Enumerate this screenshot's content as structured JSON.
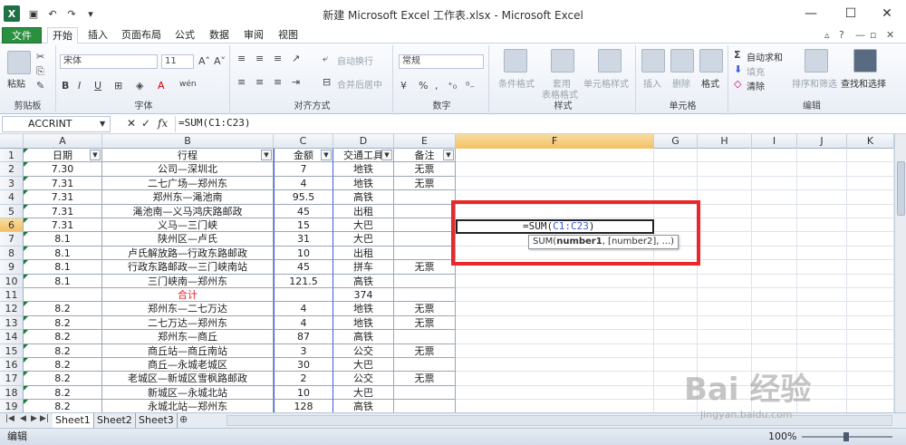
{
  "window": {
    "title": "新建 Microsoft Excel 工作表.xlsx - Microsoft Excel",
    "logo": "X"
  },
  "tabs": [
    "文件",
    "开始",
    "插入",
    "页面布局",
    "公式",
    "数据",
    "审阅",
    "视图"
  ],
  "active_tab": "开始",
  "ribbon": {
    "clipboard": {
      "label": "剪贴板",
      "paste": "粘贴"
    },
    "font": {
      "label": "字体",
      "name": "宋体",
      "size": "11",
      "bold": "B",
      "italic": "I",
      "underline": "U",
      "grow": "A˄",
      "shrink": "A˅",
      "wen": "wén"
    },
    "alignment": {
      "label": "对齐方式",
      "wrap": "自动换行",
      "merge": "合并后居中"
    },
    "number": {
      "label": "数字",
      "format": "常规",
      "pct": "%",
      "comma": ","
    },
    "styles": {
      "label": "样式",
      "conditional": "条件格式",
      "table1": "套用",
      "table2": "表格格式",
      "cell": "单元格样式"
    },
    "cells": {
      "label": "单元格",
      "insert": "插入",
      "delete": "删除",
      "format": "格式"
    },
    "editing": {
      "label": "编辑",
      "autosum": "自动求和",
      "fill": "填充",
      "clear": "清除",
      "sort": "排序和筛选",
      "find": "查找和选择"
    }
  },
  "formula_bar": {
    "name_box": "ACCRINT",
    "formula": "=SUM(C1:C23)",
    "fx": "fx"
  },
  "columns": [
    "A",
    "B",
    "C",
    "D",
    "E",
    "F",
    "G",
    "H",
    "I",
    "J",
    "K"
  ],
  "selected_column": "F",
  "selected_row": "6",
  "row_numbers": [
    "1",
    "2",
    "3",
    "4",
    "5",
    "6",
    "7",
    "8",
    "9",
    "10",
    "11",
    "12",
    "13",
    "14",
    "15",
    "16",
    "17",
    "18",
    "19"
  ],
  "table": {
    "headers": [
      "日期",
      "行程",
      "金额",
      "交通工具",
      "备注"
    ],
    "rows": [
      [
        "7.30",
        "公司—深圳北",
        "7",
        "地铁",
        "无票"
      ],
      [
        "7.31",
        "二七广场—郑州东",
        "4",
        "地铁",
        "无票"
      ],
      [
        "7.31",
        "郑州东—渑池南",
        "95.5",
        "高铁",
        ""
      ],
      [
        "7.31",
        "渑池南—义马鸿庆路邮政",
        "45",
        "出租",
        ""
      ],
      [
        "7.31",
        "义马—三门峡",
        "15",
        "大巴",
        ""
      ],
      [
        "8.1",
        "陕州区—卢氏",
        "31",
        "大巴",
        ""
      ],
      [
        "8.1",
        "卢氏解放路—行政东路邮政",
        "10",
        "出租",
        ""
      ],
      [
        "8.1",
        "行政东路邮政—三门峡南站",
        "45",
        "拼车",
        "无票"
      ],
      [
        "8.1",
        "三门峡南—郑州东",
        "121.5",
        "高铁",
        ""
      ],
      [
        "",
        "合计",
        "",
        "374",
        ""
      ],
      [
        "8.2",
        "郑州东—二七万达",
        "4",
        "地铁",
        "无票"
      ],
      [
        "8.2",
        "二七万达—郑州东",
        "4",
        "地铁",
        "无票"
      ],
      [
        "8.2",
        "郑州东—商丘",
        "87",
        "高铁",
        ""
      ],
      [
        "8.2",
        "商丘站—商丘南站",
        "3",
        "公交",
        "无票"
      ],
      [
        "8.2",
        "商丘—永城老城区",
        "30",
        "大巴",
        ""
      ],
      [
        "8.2",
        "老城区—新城区雪枫路邮政",
        "2",
        "公交",
        "无票"
      ],
      [
        "8.2",
        "新城区—永城北站",
        "10",
        "大巴",
        ""
      ],
      [
        "8.2",
        "永城北站—郑州东",
        "128",
        "高铁",
        ""
      ]
    ]
  },
  "editor": {
    "prefix": "=SUM(",
    "ref": "C1:C23",
    "suffix": ")"
  },
  "tooltip": {
    "func": "SUM(",
    "arg1": "number1",
    "rest": ", [number2], ...)"
  },
  "sheets": [
    "Sheet1",
    "Sheet2",
    "Sheet3"
  ],
  "active_sheet": "Sheet1",
  "status": {
    "mode": "编辑",
    "zoom": "100%"
  },
  "watermark": {
    "brand": "Bai 经验",
    "url": "jingyan.baidu.com"
  },
  "colors": {
    "excel_green": "#1e7145",
    "file_tab": "#2a8f3f",
    "highlight_red": "#e8282a",
    "ref_blue": "#3b5bd6",
    "total_red": "#e02020"
  }
}
